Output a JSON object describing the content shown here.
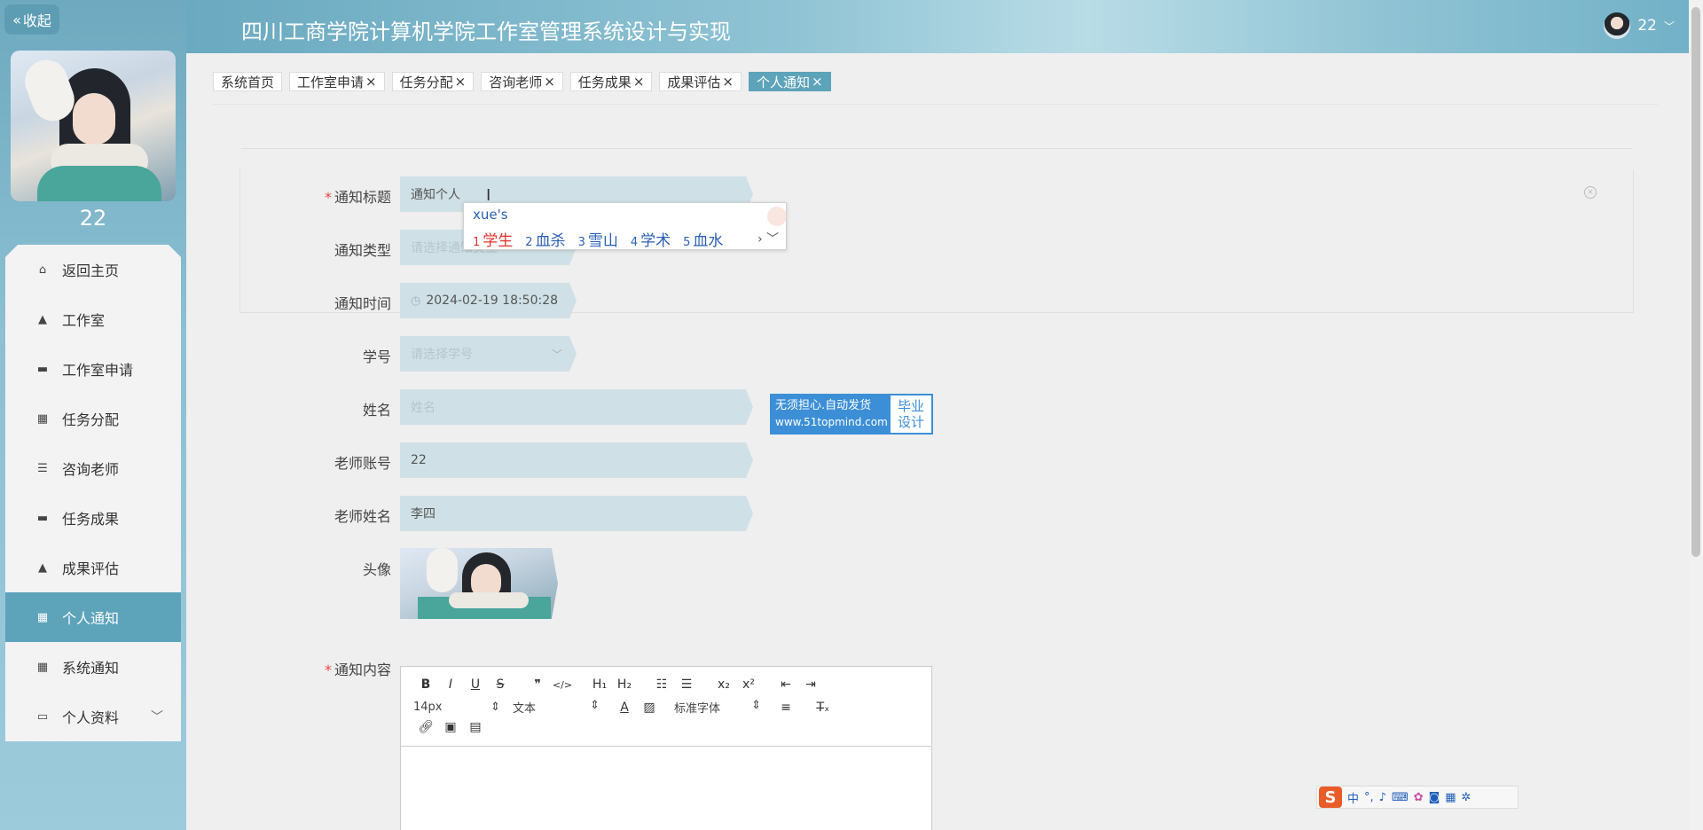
{
  "app_title": "四川工商学院计算机学院工作室管理系统设计与实现",
  "collapse_label": "收起",
  "user": {
    "name": "22"
  },
  "sidebar": {
    "username": "22",
    "items": [
      {
        "label": "返回主页",
        "icon": "home-icon"
      },
      {
        "label": "工作室",
        "icon": "person-icon"
      },
      {
        "label": "工作室申请",
        "icon": "monitor-icon"
      },
      {
        "label": "任务分配",
        "icon": "grid-icon"
      },
      {
        "label": "咨询老师",
        "icon": "list-icon"
      },
      {
        "label": "任务成果",
        "icon": "monitor-icon"
      },
      {
        "label": "成果评估",
        "icon": "person-icon"
      },
      {
        "label": "个人通知",
        "icon": "grid-icon",
        "active": true
      },
      {
        "label": "系统通知",
        "icon": "grid-icon"
      },
      {
        "label": "个人资料",
        "icon": "card-icon"
      }
    ]
  },
  "tabs": [
    {
      "label": "系统首页"
    },
    {
      "label": "工作室申请"
    },
    {
      "label": "任务分配"
    },
    {
      "label": "咨询老师"
    },
    {
      "label": "任务成果"
    },
    {
      "label": "成果评估"
    },
    {
      "label": "个人通知",
      "active": true
    }
  ],
  "form": {
    "title": {
      "label": "通知标题",
      "value": "通知个人"
    },
    "type": {
      "label": "通知类型",
      "placeholder": "请选择通知类型"
    },
    "time": {
      "label": "通知时间",
      "value": "2024-02-19 18:50:28"
    },
    "student_no": {
      "label": "学号",
      "placeholder": "请选择学号"
    },
    "name": {
      "label": "姓名",
      "placeholder": "姓名"
    },
    "teacher_account": {
      "label": "老师账号",
      "value": "22"
    },
    "teacher_name": {
      "label": "老师姓名",
      "value": "李四"
    },
    "avatar": {
      "label": "头像"
    },
    "content": {
      "label": "通知内容"
    }
  },
  "ime": {
    "pinyin": "xue's",
    "candidates": [
      {
        "num": "1",
        "text": "学生"
      },
      {
        "num": "2",
        "text": "血杀"
      },
      {
        "num": "3",
        "text": "雪山"
      },
      {
        "num": "4",
        "text": "学术"
      },
      {
        "num": "5",
        "text": "血水"
      }
    ]
  },
  "ad": {
    "line1": "无须担心.自动发货",
    "url": "www.51topmind.com",
    "right1": "毕业",
    "right2": "设计"
  },
  "editor": {
    "font_size": "14px",
    "paragraph": "文本",
    "font_family": "标准字体"
  },
  "sogou": {
    "lang": "中"
  },
  "colors": {
    "accent": "#5da3b9",
    "sidebar": "#8cc0d2",
    "field_bg": "#cfe1e6",
    "required": "#e44444"
  }
}
